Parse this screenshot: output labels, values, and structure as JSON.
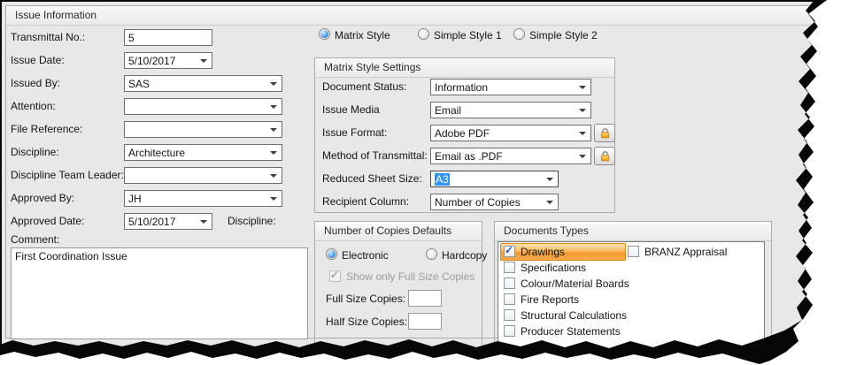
{
  "window": {
    "title": "Issue Information"
  },
  "left_form": {
    "fields": [
      {
        "label": "Transmittal No.:",
        "value": "5",
        "type": "text"
      },
      {
        "label": "Issue Date:",
        "value": "5/10/2017",
        "type": "dropdown"
      },
      {
        "label": "Issued By:",
        "value": "SAS",
        "type": "dropdown"
      },
      {
        "label": "Attention:",
        "value": "",
        "type": "dropdown"
      },
      {
        "label": "File Reference:",
        "value": "",
        "type": "dropdown"
      },
      {
        "label": "Discipline:",
        "value": "Architecture",
        "type": "dropdown"
      },
      {
        "label": "Discipline Team Leader:",
        "value": "",
        "type": "dropdown"
      },
      {
        "label": "Approved By:",
        "value": "JH",
        "type": "dropdown"
      },
      {
        "label": "Approved Date:",
        "value": "5/10/2017",
        "type": "dropdown"
      }
    ],
    "discipline_side_label": "Discipline:",
    "comment_label": "Comment:",
    "comment_value": "First Coordination Issue"
  },
  "style_options": [
    {
      "label": "Matrix Style",
      "selected": true
    },
    {
      "label": "Simple Style 1",
      "selected": false
    },
    {
      "label": "Simple Style 2",
      "selected": false
    }
  ],
  "matrix_settings": {
    "title": "Matrix Style Settings",
    "fields": [
      {
        "label": "Document Status:",
        "value": "Information",
        "locked": false
      },
      {
        "label": "Issue Media",
        "value": "Email",
        "locked": false
      },
      {
        "label": "Issue Format:",
        "value": "Adobe PDF",
        "locked": true
      },
      {
        "label": "Method of Transmittal:",
        "value": "Email as .PDF",
        "locked": true
      },
      {
        "label": "Reduced Sheet Size:",
        "value": "A3",
        "text_selected": true
      },
      {
        "label": "Recipient Column:",
        "value": "Number of Copies",
        "locked": false
      }
    ]
  },
  "copies_defaults": {
    "title": "Number of Copies Defaults",
    "radios": [
      {
        "label": "Electronic",
        "selected": true
      },
      {
        "label": "Hardcopy",
        "selected": false
      }
    ],
    "checkbox": {
      "label": "Show only Full Size Copies",
      "checked": true,
      "disabled": true
    },
    "inputs": [
      {
        "label": "Full Size Copies:",
        "value": ""
      },
      {
        "label": "Half Size Copies:",
        "value": ""
      }
    ]
  },
  "document_types": {
    "title": "Documents Types",
    "col1": [
      {
        "label": "Drawings",
        "checked": true,
        "selected": true
      },
      {
        "label": "Specifications",
        "checked": false
      },
      {
        "label": "Colour/Material Boards",
        "checked": false
      },
      {
        "label": "Fire Reports",
        "checked": false
      },
      {
        "label": "Structural Calculations",
        "checked": false
      },
      {
        "label": "Producer Statements",
        "checked": false
      }
    ],
    "col2": [
      {
        "label": "BRANZ Appraisal",
        "checked": false
      }
    ]
  },
  "colors": {
    "panel_bg": "#e8e8e9",
    "selection_blue": "#2f95fb",
    "selection_orange": "#f39b34",
    "lock_gold": "#f7a600",
    "radio_blue": "#1f7cd2"
  }
}
